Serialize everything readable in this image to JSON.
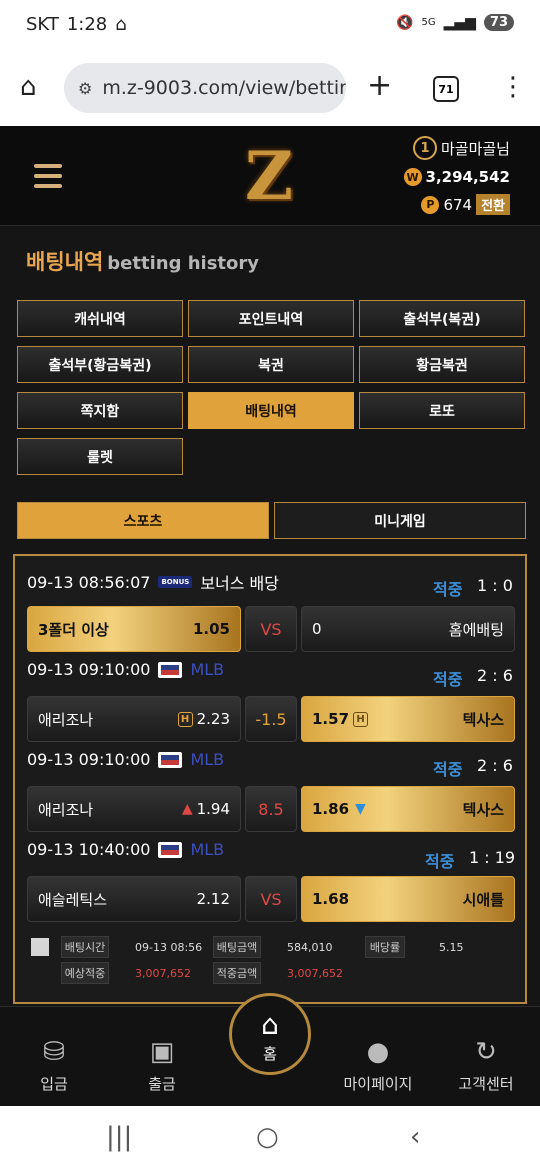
{
  "status": {
    "carrier": "SKT",
    "time": "1:28",
    "battery": "73",
    "network": "5G"
  },
  "browser": {
    "url": "m.z-9003.com/view/betting",
    "tabs": "71"
  },
  "header": {
    "rank": "1",
    "username": "마골마골님",
    "won_balance": "3,294,542",
    "points": "674",
    "convert_label": "전환",
    "logo": "Z"
  },
  "page": {
    "title": "배팅내역",
    "subtitle": "betting history"
  },
  "menu": [
    {
      "label": "캐쉬내역",
      "active": false
    },
    {
      "label": "포인트내역",
      "active": false
    },
    {
      "label": "출석부(복권)",
      "active": false
    },
    {
      "label": "출석부(황금복권)",
      "active": false
    },
    {
      "label": "복권",
      "active": false
    },
    {
      "label": "황금복권",
      "active": false
    },
    {
      "label": "쪽지함",
      "active": false
    },
    {
      "label": "배팅내역",
      "active": true
    },
    {
      "label": "로또",
      "active": false
    },
    {
      "label": "룰렛",
      "active": false
    }
  ],
  "subtabs": {
    "sports": "스포츠",
    "minigame": "미니게임"
  },
  "bets": [
    {
      "datetime": "09-13 08:56:07",
      "badge": "BONUS",
      "league": "보너스 배당",
      "result": "적중",
      "score": "1 : 0",
      "home": "3폴더 이상",
      "home_odds": "1.05",
      "mid": "VS",
      "away": "홈에배팅",
      "away_odds": "0"
    },
    {
      "datetime": "09-13 09:10:00",
      "league": "MLB",
      "result": "적중",
      "score": "2 : 6",
      "home": "애리조나",
      "home_odds": "2.23",
      "mid": "-1.5",
      "away": "텍사스",
      "away_odds": "1.57"
    },
    {
      "datetime": "09-13 09:10:00",
      "league": "MLB",
      "result": "적중",
      "score": "2 : 6",
      "home": "애리조나",
      "home_odds": "1.94",
      "mid": "8.5",
      "away": "텍사스",
      "away_odds": "1.86"
    },
    {
      "datetime": "09-13 10:40:00",
      "league": "MLB",
      "result": "적중",
      "score": "1 : 19",
      "home": "애슬레틱스",
      "home_odds": "2.12",
      "mid": "VS",
      "away": "시애틀",
      "away_odds": "1.68"
    }
  ],
  "summary": {
    "bet_time_label": "배팅시간",
    "bet_time": "09-13 08:56",
    "bet_amount_label": "배팅금액",
    "bet_amount": "584,010",
    "odds_label": "배당률",
    "odds": "5.15",
    "expected_label": "예상적중",
    "expected": "3,007,652",
    "win_label": "적중금액",
    "win": "3,007,652"
  },
  "bottomnav": {
    "deposit": "입금",
    "withdraw": "출금",
    "home": "홈",
    "mypage": "마이페이지",
    "support": "고객센터"
  }
}
